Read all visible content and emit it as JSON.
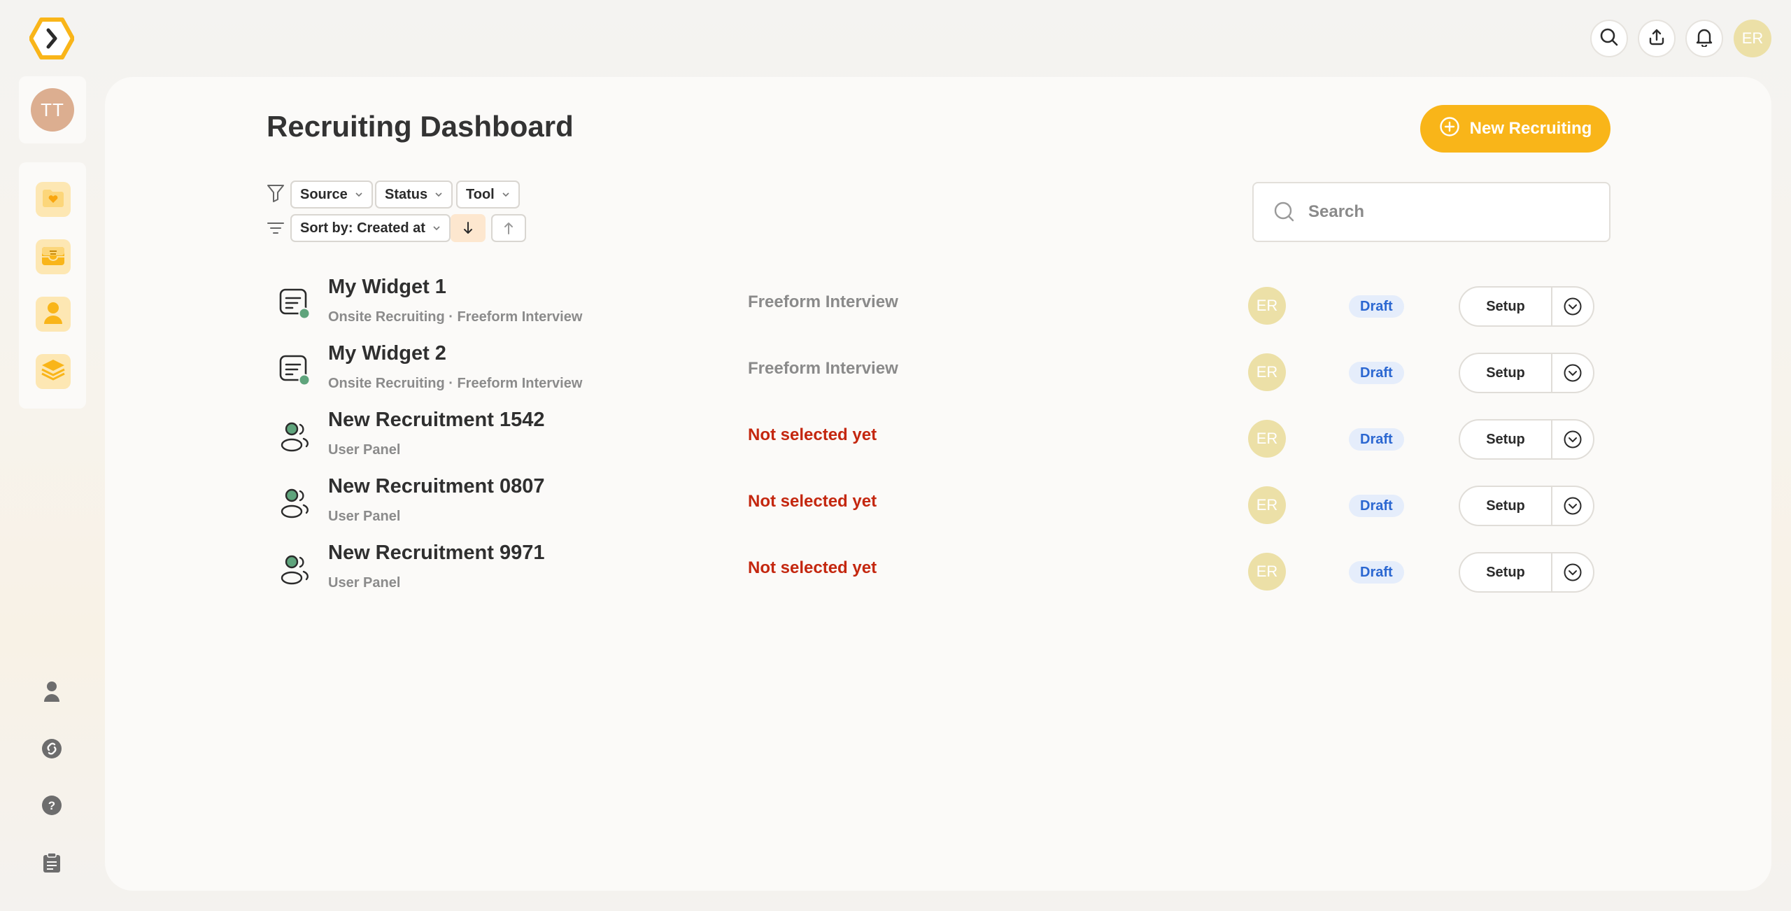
{
  "app": {
    "workspace_initials": "TT",
    "user_initials": "ER"
  },
  "header": {
    "title": "Recruiting Dashboard",
    "new_button_label": "New Recruiting"
  },
  "filters": {
    "chips": [
      "Source",
      "Status",
      "Tool"
    ],
    "sort_label": "Sort by: Created at",
    "search_placeholder": "Search"
  },
  "rows": [
    {
      "title": "My Widget 1",
      "subtitle": "Onsite Recruiting · Freeform Interview",
      "method": "Freeform Interview",
      "method_selected": true,
      "icon": "widget-doc-icon",
      "owner": "ER",
      "status": "Draft",
      "action": "Setup"
    },
    {
      "title": "My Widget 2",
      "subtitle": "Onsite Recruiting · Freeform Interview",
      "method": "Freeform Interview",
      "method_selected": true,
      "icon": "widget-doc-icon",
      "owner": "ER",
      "status": "Draft",
      "action": "Setup"
    },
    {
      "title": "New Recruitment 1542",
      "subtitle": "User Panel",
      "method": "Not selected yet",
      "method_selected": false,
      "icon": "user-panel-icon",
      "owner": "ER",
      "status": "Draft",
      "action": "Setup"
    },
    {
      "title": "New Recruitment 0807",
      "subtitle": "User Panel",
      "method": "Not selected yet",
      "method_selected": false,
      "icon": "user-panel-icon",
      "owner": "ER",
      "status": "Draft",
      "action": "Setup"
    },
    {
      "title": "New Recruitment 9971",
      "subtitle": "User Panel",
      "method": "Not selected yet",
      "method_selected": false,
      "icon": "user-panel-icon",
      "owner": "ER",
      "status": "Draft",
      "action": "Setup"
    }
  ],
  "colors": {
    "accent": "#f9b519",
    "draft_text": "#2b67d1",
    "draft_bg": "#e5edfb",
    "not_selected": "#c4270f",
    "avatar_bg": "#ece0a7"
  }
}
